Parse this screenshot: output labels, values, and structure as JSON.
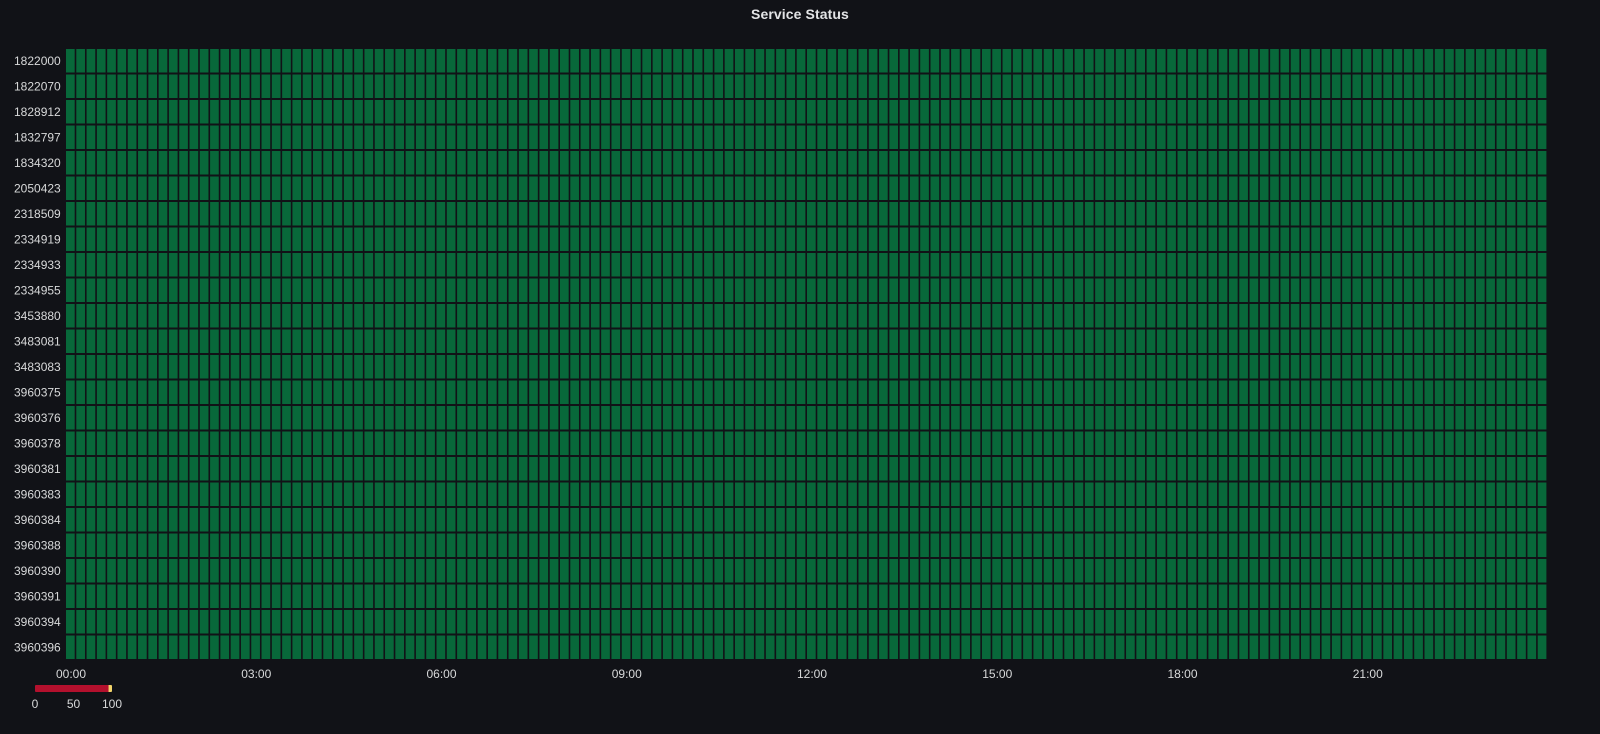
{
  "panel": {
    "title": "Service Status"
  },
  "chart_data": {
    "type": "heatmap",
    "title": "Service Status",
    "rows": [
      "1822000",
      "1822070",
      "1828912",
      "1832797",
      "1834320",
      "2050423",
      "2318509",
      "2334919",
      "2334933",
      "2334955",
      "3453880",
      "3483081",
      "3483083",
      "3960375",
      "3960376",
      "3960378",
      "3960381",
      "3960383",
      "3960384",
      "3960388",
      "3960390",
      "3960391",
      "3960394",
      "3960396"
    ],
    "x_tick_labels": [
      "00:00",
      "03:00",
      "06:00",
      "09:00",
      "12:00",
      "15:00",
      "18:00",
      "21:00"
    ],
    "x_range_hours": [
      0,
      24
    ],
    "bucket_minutes": 10,
    "bucket_count": 144,
    "cell_value_all": 100,
    "value_range": [
      0,
      100
    ],
    "color_scale": {
      "labels": [
        "0",
        "50",
        "100"
      ],
      "low_color": "#b3102d",
      "high_color": "#f2d46b"
    },
    "cell_color": "#08683a",
    "grid": false,
    "legend_position": "bottom-left"
  }
}
